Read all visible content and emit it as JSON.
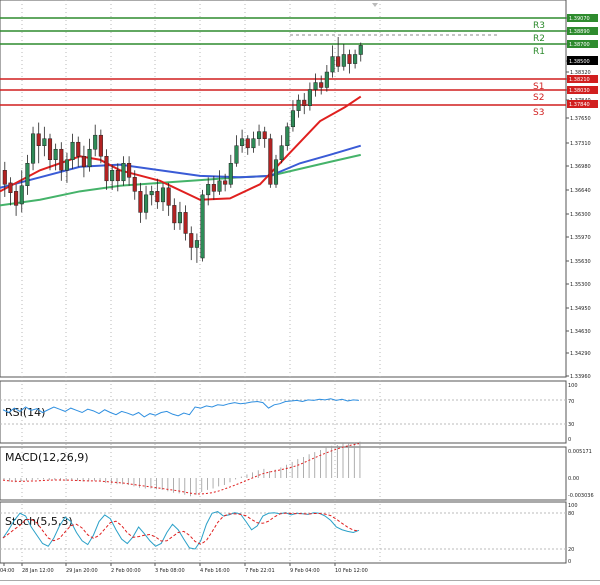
{
  "colors": {
    "bull": "#2e8b57",
    "bear": "#b22222",
    "resistance": "#2e8b2e",
    "support": "#d11f1f",
    "ma_red": "#e0201f",
    "ma_blue": "#3a5bd6",
    "ma_green": "#45b36a",
    "rsi": "#2f8fe0",
    "macd_signal": "#e02020",
    "stoch_main": "#2aa0c8",
    "stoch_signal": "#e02020",
    "grid": "#b9b9b9"
  },
  "chart": {
    "price_axis_labels": [
      "1.39070",
      "1.38890",
      "1.38700",
      "1.38500",
      "1.38320",
      "1.38210",
      "1.38030",
      "1.37840",
      "1.37650",
      "1.37310",
      "1.36980",
      "1.36640",
      "1.36300",
      "1.35970",
      "1.35630",
      "1.35300",
      "1.34950",
      "1.34630",
      "1.34290",
      "1.33960"
    ],
    "levels": [
      {
        "name": "R3",
        "price": "1.39070",
        "kind": "resistance"
      },
      {
        "name": "R2",
        "price": "1.38890",
        "kind": "resistance"
      },
      {
        "name": "R1",
        "price": "1.38700",
        "kind": "resistance"
      },
      {
        "name": "S1",
        "price": "1.38210",
        "kind": "support"
      },
      {
        "name": "S2",
        "price": "1.38030",
        "kind": "support"
      },
      {
        "name": "S3",
        "price": "1.37840",
        "kind": "support"
      }
    ],
    "current_price": "1.38500",
    "time_labels": [
      "04:00",
      "28 Jan 12:00",
      "29 Jan 20:00",
      "2 Feb 00:00",
      "3 Feb 08:00",
      "4 Feb 16:00",
      "7 Feb 22:01",
      "9 Feb 04:00",
      "10 Feb 12:00"
    ]
  },
  "indicators": {
    "rsi": {
      "label": "RSI(14)",
      "axis": [
        "100",
        "70",
        "30",
        "0"
      ]
    },
    "macd": {
      "label": "MACD(12,26,9)",
      "axis": [
        "0.005171",
        "0.00",
        "-0.003036"
      ]
    },
    "stoch": {
      "label": "Stoch(5,5,3)",
      "axis": [
        "100",
        "80",
        "20",
        "0"
      ]
    }
  }
}
